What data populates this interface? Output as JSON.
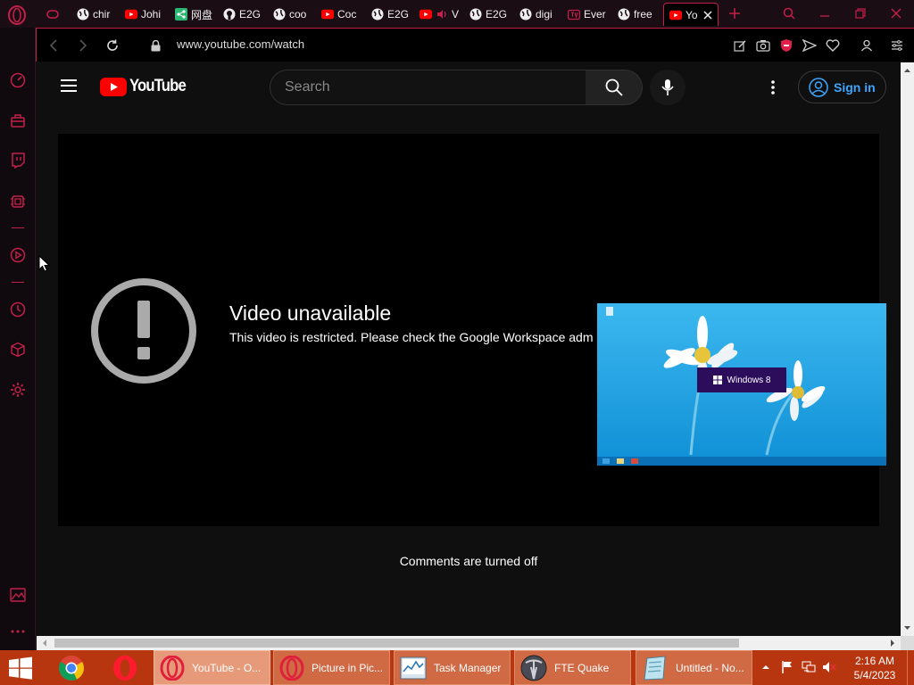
{
  "browser": {
    "tabs": [
      {
        "label": "chir",
        "icon": "globe-icon"
      },
      {
        "label": "Johi",
        "icon": "youtube-icon"
      },
      {
        "label": "网盘",
        "icon": "share-icon"
      },
      {
        "label": "E2G",
        "icon": "github-icon"
      },
      {
        "label": "coo",
        "icon": "globe-icon"
      },
      {
        "label": "Coc",
        "icon": "youtube-icon"
      },
      {
        "label": "E2G",
        "icon": "globe-icon"
      },
      {
        "label": "V",
        "icon": "youtube-icon"
      },
      {
        "label": "E2G",
        "icon": "globe-icon"
      },
      {
        "label": "digi",
        "icon": "globe-icon"
      },
      {
        "label": "Ever",
        "icon": "tv-icon"
      },
      {
        "label": "free",
        "icon": "globe-icon"
      },
      {
        "label": "Yo",
        "icon": "youtube-icon",
        "active": true
      }
    ],
    "url": "www.youtube.com/watch",
    "accent": "#c21f4a"
  },
  "youtube": {
    "logo_text": "YouTube",
    "search_placeholder": "Search",
    "sign_in": "Sign in"
  },
  "video": {
    "title": "Video unavailable",
    "message": "This video is restricted. Please check the Google Workspace adm restrictions."
  },
  "comments": {
    "status": "Comments are turned off"
  },
  "pip": {
    "label": "Windows 8"
  },
  "taskbar": {
    "buttons": [
      {
        "label": "YouTube - O...",
        "icon": "opera-icon"
      },
      {
        "label": "Picture in Pic...",
        "icon": "opera-icon"
      },
      {
        "label": "Task Manager",
        "icon": "task-manager-icon"
      },
      {
        "label": "FTE Quake",
        "icon": "quake-icon"
      },
      {
        "label": "Untitled - No...",
        "icon": "notepad-icon"
      }
    ],
    "time": "2:16 AM",
    "date": "5/4/2023"
  }
}
